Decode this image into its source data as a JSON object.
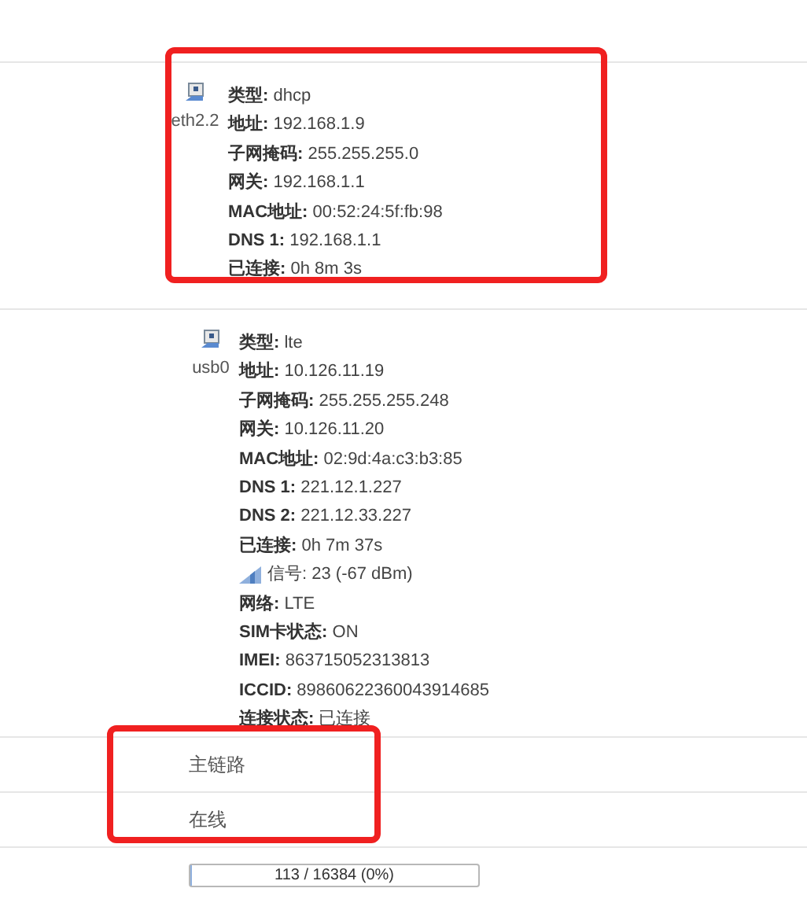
{
  "interfaces": [
    {
      "name": "eth2.2",
      "highlighted": true,
      "details": [
        {
          "kind": "field",
          "label": "类型:",
          "value": "dhcp"
        },
        {
          "kind": "field",
          "label": "地址:",
          "value": "192.168.1.9"
        },
        {
          "kind": "field",
          "label": "子网掩码:",
          "value": "255.255.255.0"
        },
        {
          "kind": "field",
          "label": "网关:",
          "value": "192.168.1.1"
        },
        {
          "kind": "field",
          "label": "MAC地址:",
          "value": "00:52:24:5f:fb:98"
        },
        {
          "kind": "field",
          "label": "DNS 1:",
          "value": "192.168.1.1"
        },
        {
          "kind": "field",
          "label": "已连接:",
          "value": "0h 8m 3s"
        }
      ]
    },
    {
      "name": "usb0",
      "highlighted": false,
      "details": [
        {
          "kind": "field",
          "label": "类型:",
          "value": "lte"
        },
        {
          "kind": "field",
          "label": "地址:",
          "value": "10.126.11.19"
        },
        {
          "kind": "field",
          "label": "子网掩码:",
          "value": "255.255.255.248"
        },
        {
          "kind": "field",
          "label": "网关:",
          "value": "10.126.11.20"
        },
        {
          "kind": "field",
          "label": "MAC地址:",
          "value": "02:9d:4a:c3:b3:85"
        },
        {
          "kind": "field",
          "label": "DNS 1:",
          "value": "221.12.1.227"
        },
        {
          "kind": "field",
          "label": "DNS 2:",
          "value": "221.12.33.227"
        },
        {
          "kind": "field",
          "label": "已连接:",
          "value": "0h 7m 37s"
        },
        {
          "kind": "signal",
          "text": "信号: 23 (-67 dBm)"
        },
        {
          "kind": "field",
          "label": "网络:",
          "value": "LTE"
        },
        {
          "kind": "field",
          "label": "SIM卡状态:",
          "value": "ON"
        },
        {
          "kind": "field",
          "label": "IMEI:",
          "value": "863715052313813"
        },
        {
          "kind": "field",
          "label": "ICCID:",
          "value": "89860622360043914685"
        },
        {
          "kind": "field",
          "label": "连接状态:",
          "value": "已连接"
        }
      ]
    }
  ],
  "status": {
    "highlighted": true,
    "rows": [
      "主链路",
      "在线"
    ]
  },
  "progress": {
    "level": 0.007,
    "text": "113 / 16384 (0%)"
  }
}
